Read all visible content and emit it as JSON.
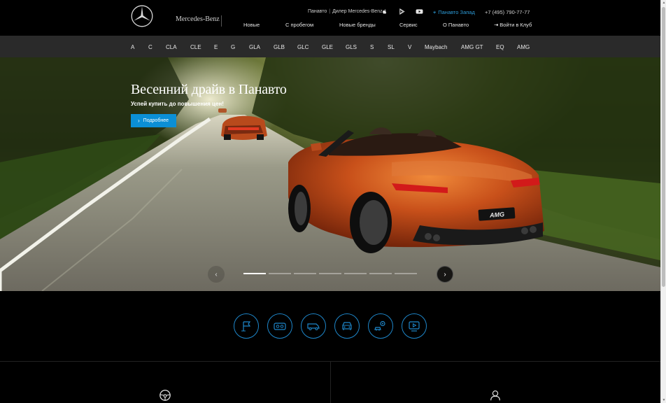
{
  "header": {
    "brand": "Mercedes-Benz",
    "dealer_left": "Панавто",
    "dealer_sep": "|",
    "dealer_right": "Дилер Mercedes-Benz",
    "social": [
      "apple-icon",
      "play-store-icon",
      "youtube-icon"
    ],
    "location": "Панавто Запад",
    "phone": "+7 (495) 790-77-77",
    "nav": [
      "Новые",
      "С пробегом",
      "Новые бренды",
      "Сервис",
      "О Панавто"
    ],
    "login": "Войти в Клуб"
  },
  "models": [
    "A",
    "C",
    "CLA",
    "CLE",
    "E",
    "G",
    "GLA",
    "GLB",
    "GLC",
    "GLE",
    "GLS",
    "S",
    "SL",
    "V",
    "Maybach",
    "AMG GT",
    "EQ",
    "AMG"
  ],
  "hero": {
    "title": "Весенний драйв в Панавто",
    "subtitle": "Успей купить до повышения цен!",
    "button": "Подробнее",
    "car_badge": "AMG",
    "slides_total": 7,
    "active_slide": 1
  },
  "quick_icons": [
    "test-drive-flag-icon",
    "vr-showroom-icon",
    "van-icon",
    "car-front-icon",
    "car-settings-icon",
    "video-icon"
  ],
  "colors": {
    "accent": "#0b8fd6",
    "icon_ring": "#1e86c9",
    "model_bar": "#2a2a2a",
    "car_orange": "#c8501a"
  }
}
